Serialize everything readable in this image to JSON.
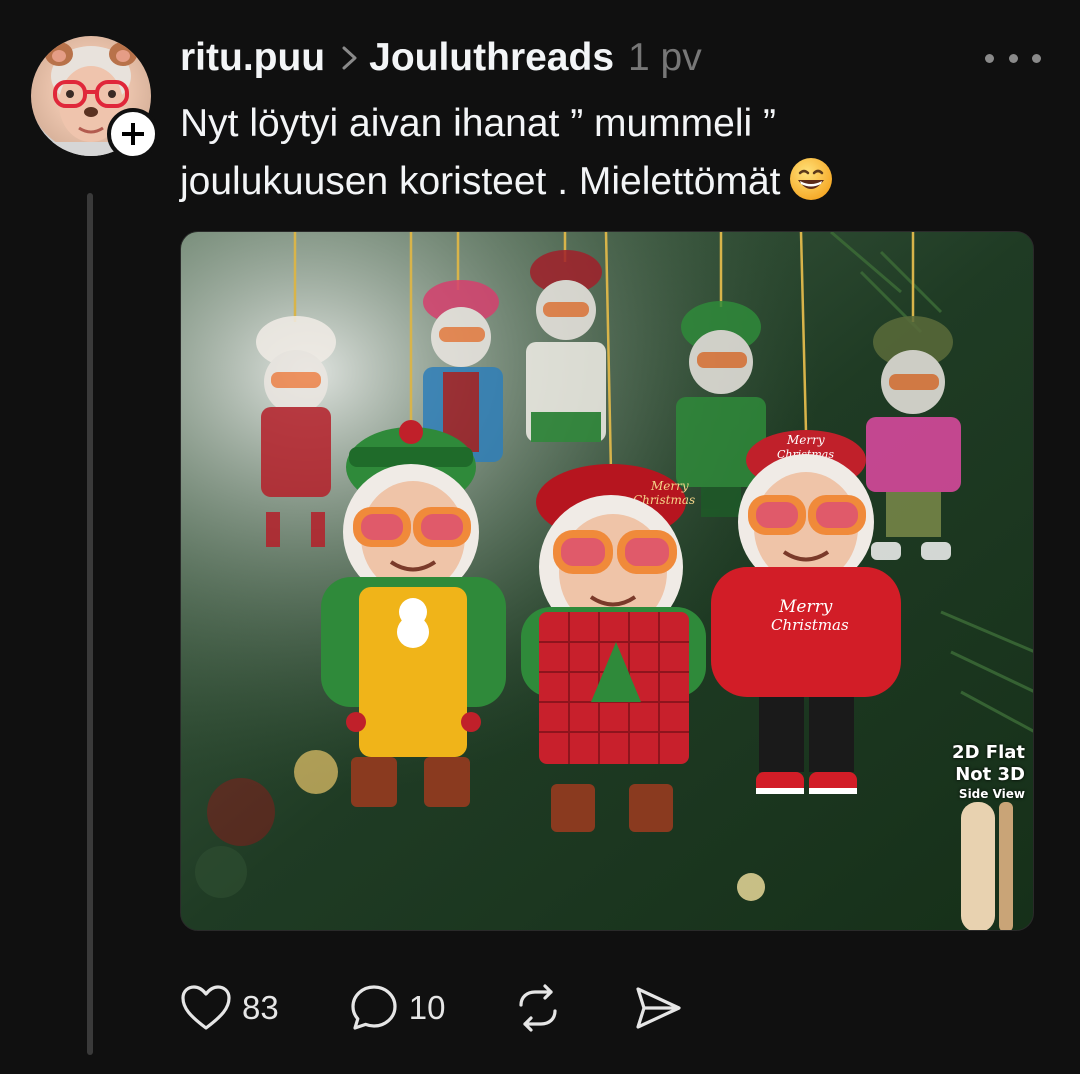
{
  "post": {
    "author": {
      "username": "ritu.puu",
      "avatar_icon": "avatar-photo",
      "follow_icon": "plus-icon"
    },
    "community": "Jouluthreads",
    "timestamp": "1 pv",
    "text_line1": "Nyt löytyi aivan ihanat ” mummeli ”",
    "text_line2": "joulukuusen koristeet . Mielettömät",
    "emoji": "grinning-face-emoji",
    "image": {
      "overlay_line1": "2D Flat",
      "overlay_line2": "Not 3D",
      "overlay_line3": "Side View",
      "sign_merry1": "Merry",
      "sign_christmas1": "Christmas",
      "sign_merry2": "Merry",
      "sign_christmas2": "Christmas",
      "sign_merry3": "Merry",
      "sign_christmas3": "Christmas",
      "sign_merry4": "Merry",
      "sign_christmas4": "Christmas"
    },
    "actions": {
      "like_count": "83",
      "comment_count": "10"
    }
  },
  "colors": {
    "background": "#101010",
    "text": "#f3f5f7",
    "muted": "#777777",
    "thread_line": "#3a3a3a"
  }
}
